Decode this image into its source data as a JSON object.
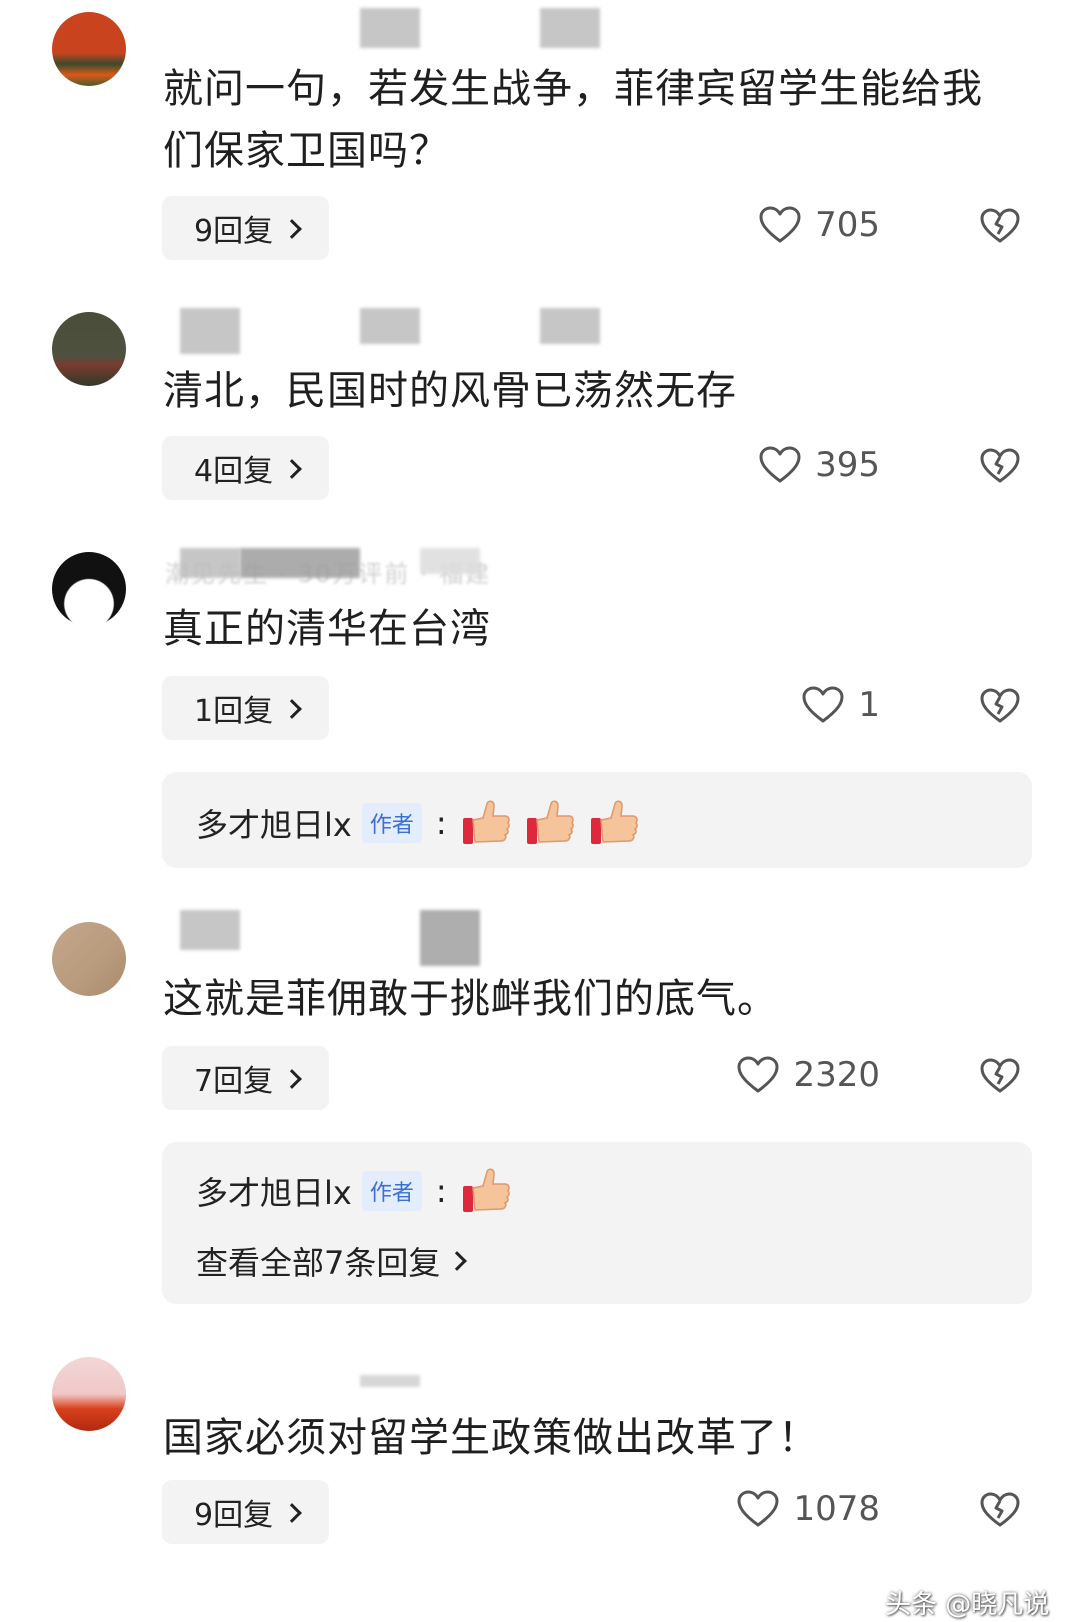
{
  "comments": [
    {
      "text": "就问一句，若发生战争，菲律宾留学生能给我们保家卫国吗？",
      "replies_label": "9回复",
      "likes": "705"
    },
    {
      "text": "清北，民国时的风骨已荡然无存",
      "replies_label": "4回复",
      "likes": "395"
    },
    {
      "meta_blurred": "潮见先生 · 30万评前 · 福建",
      "text": "真正的清华在台湾",
      "replies_label": "1回复",
      "likes": "1",
      "author_reply": {
        "name": "多才旭日lx",
        "tag": "作者",
        "colon": ":"
      }
    },
    {
      "text": "这就是菲佣敢于挑衅我们的底气。",
      "replies_label": "7回复",
      "likes": "2320",
      "author_reply": {
        "name": "多才旭日lx",
        "tag": "作者",
        "colon": ":",
        "view_all": "查看全部7条回复"
      }
    },
    {
      "text": "国家必须对留学生政策做出改革了！",
      "replies_label": "9回复",
      "likes": "1078"
    }
  ],
  "watermark": "头条 @晓凡说",
  "icons": {
    "like": "heart-outline-icon",
    "dislike": "broken-heart-icon",
    "reaction": "thumbs-up-emoji"
  },
  "colors": {
    "reply_bg": "#f3f3f3",
    "author_tag_bg": "#e4edfb",
    "author_tag_text": "#3b6fd4"
  }
}
